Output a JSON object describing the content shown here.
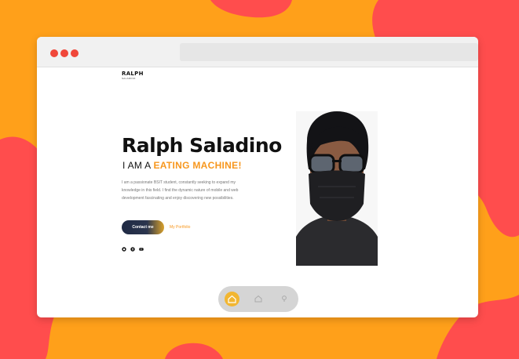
{
  "browser": {
    "window_controls": [
      "close-dot",
      "minimize-dot",
      "maximize-dot"
    ]
  },
  "header": {
    "logo_main": "RALPH",
    "logo_sub": "SALADINO"
  },
  "hero": {
    "name": "Ralph Saladino",
    "role_prefix": "I AM A",
    "role_highlight": "EATING MACHINE!",
    "bio": "I am a passionate BSIT student, constantly seeking to expand my knowledge in this field. I find the dynamic nature of mobile and web development fascinating and enjoy discovering new possibilities.",
    "contact_button": "Contact me",
    "portfolio_link": "My Portfolio"
  },
  "socials": [
    "github-icon",
    "facebook-icon",
    "youtube-icon"
  ],
  "dock": {
    "items": [
      "home-icon",
      "house-icon",
      "location-icon"
    ]
  },
  "colors": {
    "background": "#ffa01a",
    "blob": "#ff4d4d",
    "accent": "#f7971e",
    "dock_active": "#f2b631",
    "button_dark": "#1f2a44"
  }
}
